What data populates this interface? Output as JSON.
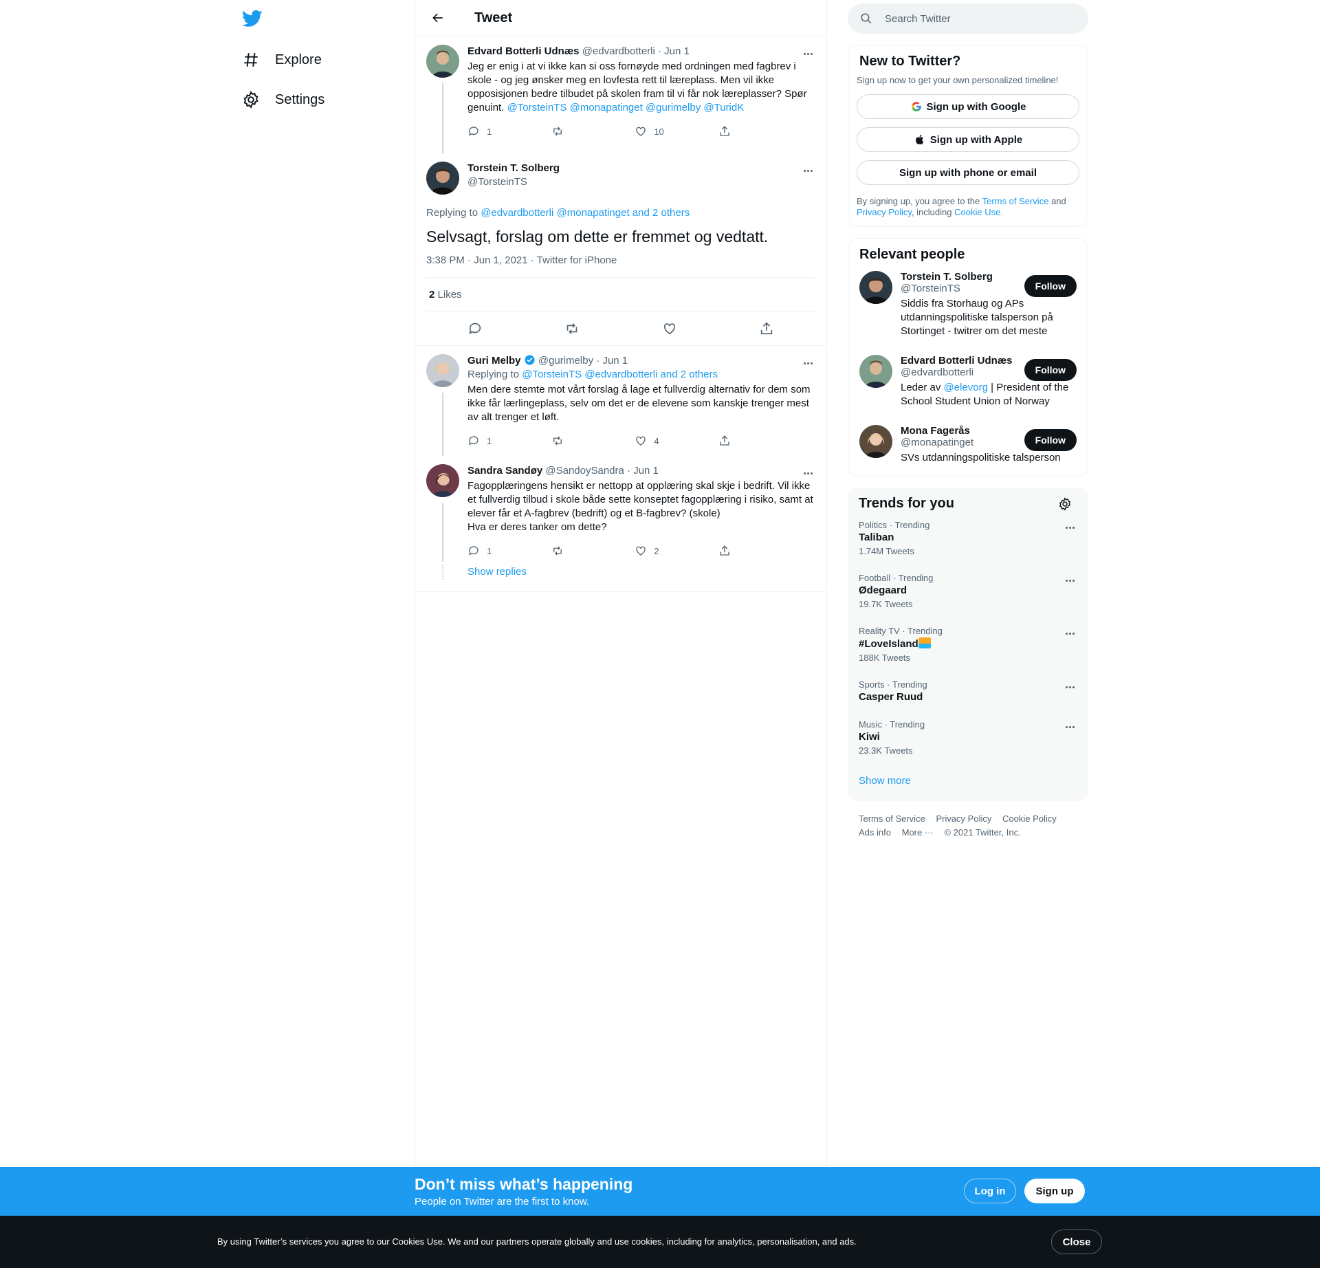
{
  "nav": {
    "items": [
      {
        "label": "Explore",
        "icon": "hashtag-icon"
      },
      {
        "label": "Settings",
        "icon": "gear-icon"
      }
    ]
  },
  "header": {
    "title": "Tweet"
  },
  "tweets": {
    "parent": {
      "name": "Edvard Botterli Udnæs",
      "handle": "@edvardbotterli",
      "date": "· Jun 1",
      "text": "Jeg er enig i at vi ikke kan si oss fornøyde med ordningen med fagbrev i skole - og jeg ønsker meg en lovfesta rett til læreplass. Men vil ikke opposisjonen bedre tilbudet på skolen fram til vi får nok læreplasser? Spør genuint.",
      "mentions": "@TorsteinTS @monapatinget @gurimelby @TuridK",
      "replies": "1",
      "retweets": "",
      "likes": "10"
    },
    "main": {
      "name": "Torstein T. Solberg",
      "handle": "@TorsteinTS",
      "replying_prefix": "Replying to",
      "replying_to": "@edvardbotterli @monapatinget and 2 others",
      "text": "Selvsagt, forslag om dette er fremmet og vedtatt.",
      "meta": "3:38 PM · Jun 1, 2021 · Twitter for iPhone",
      "likes_count": "2",
      "likes_label": "Likes"
    },
    "reply1": {
      "name": "Guri Melby",
      "handle": "@gurimelby",
      "date": "· Jun 1",
      "replying_prefix": "Replying to",
      "replying_to": "@TorsteinTS @edvardbotterli and 2 others",
      "text": "Men dere stemte mot vårt forslag å lage et fullverdig alternativ for dem som ikke får lærlingeplass, selv om det er de elevene som kanskje trenger mest av alt trenger et løft.",
      "replies": "1",
      "retweets": "",
      "likes": "4"
    },
    "reply2": {
      "name": "Sandra Sandøy",
      "handle": "@SandoySandra",
      "date": "· Jun 1",
      "text1": "Fagopplæringens hensikt er nettopp at opplæring skal skje i bedrift. Vil ikke et fullverdig tilbud i skole både sette konseptet fagopplæring i risiko, samt at elever får et A-fagbrev (bedrift) og et B-fagbrev? (skole)",
      "text2": "Hva er deres tanker om dette?",
      "replies": "1",
      "retweets": "",
      "likes": "2"
    },
    "show_replies": "Show replies"
  },
  "search": {
    "placeholder": "Search Twitter"
  },
  "new_to_twitter": {
    "title": "New to Twitter?",
    "subtitle": "Sign up now to get your own personalized timeline!",
    "google": "Sign up with Google",
    "apple": "Sign up with Apple",
    "phone": "Sign up with phone or email",
    "legal_1": "By signing up, you agree to the",
    "tos": "Terms of Service",
    "legal_2": "and",
    "privacy": "Privacy Policy",
    "legal_3": ", including",
    "cookie": "Cookie Use."
  },
  "relevant": {
    "title": "Relevant people",
    "follow_label": "Follow",
    "people": [
      {
        "name": "Torstein T. Solberg",
        "handle": "@TorsteinTS",
        "bio": "Siddis fra Storhaug og APs utdanningspolitiske talsperson på Stortinget - twitrer om det meste"
      },
      {
        "name": "Edvard Botterli Udnæs",
        "handle": "@edvardbotterli",
        "bio_prefix": "Leder av",
        "bio_link": "@elevorg",
        "bio_suffix": "| President of the School Student Union of Norway"
      },
      {
        "name": "Mona Fagerås",
        "handle": "@monapatinget",
        "bio": "SVs utdanningspolitiske talsperson"
      }
    ]
  },
  "trends": {
    "title": "Trends for you",
    "items": [
      {
        "meta": "Politics · Trending",
        "name": "Taliban",
        "count": "1.74M Tweets"
      },
      {
        "meta": "Football · Trending",
        "name": "Ødegaard",
        "count": "19.7K Tweets"
      },
      {
        "meta": "Reality TV · Trending",
        "name": "#LoveIsland",
        "count": "188K Tweets"
      },
      {
        "meta": "Sports · Trending",
        "name": "Casper Ruud",
        "count": ""
      },
      {
        "meta": "Music · Trending",
        "name": "Kiwi",
        "count": "23.3K Tweets"
      }
    ],
    "show_more": "Show more"
  },
  "footer": {
    "links": [
      "Terms of Service",
      "Privacy Policy",
      "Cookie Policy",
      "Ads info",
      "More ···",
      "© 2021 Twitter, Inc."
    ]
  },
  "signup_bar": {
    "title": "Don’t miss what’s happening",
    "subtitle": "People on Twitter are the first to know.",
    "login": "Log in",
    "signup": "Sign up"
  },
  "cookie_bar": {
    "text": "By using Twitter’s services you agree to our Cookies Use. We and our partners operate globally and use cookies, including for analytics, personalisation, and ads.",
    "close": "Close"
  },
  "colors": {
    "accent": "#1d9bf0",
    "text": "#0f1419",
    "muted": "#536471"
  }
}
